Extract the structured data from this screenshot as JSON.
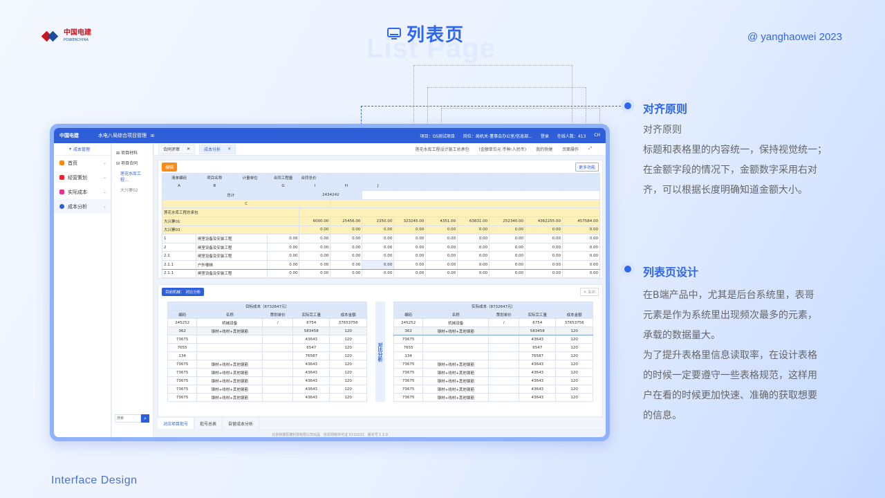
{
  "brand": {
    "name": "中国电建",
    "sub": "POWERCHINA"
  },
  "page": {
    "title": "列表页",
    "title_bg": "List Page",
    "author": "@ yanghaowei   2023",
    "footer": "Interface Design"
  },
  "colors": {
    "accent": "#2f66f0",
    "brand_red": "#c8161d",
    "warning": "#fa8c16"
  },
  "sections": [
    {
      "title": "对齐原则",
      "lines": [
        "对齐原则",
        "标题和表格里的内容统一，保持视觉统一；",
        "在金额字段的情况下，金额数字采用右对",
        "齐，可以根据长度明确知道金额大小。"
      ]
    },
    {
      "title": "列表页设计",
      "lines": [
        "在B端产品中，尤其是后台系统里，表哥",
        "元素是作为系统里出现频次最多的元素，",
        "承载的数据量大。",
        "为了提升表格里信息读取率，在设计表格",
        "的时候一定要遵守一些表格规范，这样用",
        "户在看的时候更加快速、准确的获取想要",
        "的信息。"
      ]
    }
  ],
  "app": {
    "brand": "中国电建",
    "brand_sub": "POWERCHINA",
    "name": "水电八局综合项目管理",
    "topbar": {
      "project": "项目：GS测试项目",
      "org": "岗位：局机关-董事会办公室/信息部...",
      "user": "登录",
      "online": "在线人数：413",
      "lang": "CH"
    },
    "side_header": "成本管理",
    "menu": [
      {
        "label": "首页",
        "icon": "home-icon",
        "color": "#fa8c16"
      },
      {
        "label": "经营策划",
        "icon": "plan-icon",
        "color": "#f5222d"
      },
      {
        "label": "实际成本",
        "icon": "cost-icon",
        "color": "#eb2f96"
      },
      {
        "label": "成本分析",
        "icon": "analysis-icon",
        "color": "#2f5fd8"
      }
    ],
    "tree": [
      "项目材料",
      "项目合同",
      "莲花水库工程...",
      "大兴寨02"
    ],
    "search_placeholder": "搜索",
    "tabs": [
      {
        "label": "合同评审"
      },
      {
        "label": "成本分析"
      }
    ],
    "tab_right": [
      "莲花水库工程设计施工总承包",
      "(金额单位元  币种:人民币)",
      "我的快捷",
      "页面操作"
    ],
    "btn_edit": "编辑",
    "btn_more": "更多功能",
    "main_header": [
      "清单编码",
      "项目名称",
      "计量单位",
      "合同工程量",
      "合同总价"
    ],
    "main_letters": [
      "A",
      "B",
      "",
      "G",
      "I",
      "H",
      "J"
    ],
    "total_label": "总计",
    "total_value": "2434242",
    "c_label": "C",
    "group_row": "莲花水库工程总承包",
    "rows": [
      {
        "code": "大兴寨01",
        "name": "",
        "vals": [
          "6000.00",
          "25456.00",
          "2350.00",
          "323245.00",
          "4351.00",
          "63831.00",
          "252340.00",
          "4362255.00",
          "457584.00"
        ],
        "style": "yel"
      },
      {
        "code": "大兴寨03",
        "name": "",
        "vals": [
          "0.00",
          "0.00",
          "0.00",
          "0.00",
          "0.00",
          "0.00",
          "0.00",
          "0.00",
          "0.00"
        ],
        "style": "yel"
      },
      {
        "code": "1",
        "name": "闸室设备及安装工程",
        "q": "0.00",
        "vals": [
          "0.00",
          "0.00",
          "0.00",
          "0.00",
          "0.00",
          "0.00",
          "0.00",
          "0.00",
          "0.00"
        ]
      },
      {
        "code": "2",
        "name": "闸室设备及安装工程",
        "q": "0.00",
        "vals": [
          "0.00",
          "0.00",
          "0.00",
          "0.00",
          "0.00",
          "0.00",
          "0.00",
          "0.00",
          "0.00"
        ]
      },
      {
        "code": "2.1",
        "name": "闸室设备及安装工程",
        "q": "0.00",
        "vals": [
          "0.00",
          "0.00",
          "0.00",
          "0.00",
          "0.00",
          "0.00",
          "0.00",
          "0.00",
          "0.00"
        ]
      },
      {
        "code": "2.1.1",
        "name": "户外楼梯",
        "q": "0.00",
        "vals": [
          "0.00",
          "0.00",
          "0.00",
          "0.00",
          "0.00",
          "0.00",
          "0.00",
          "0.00",
          "0.00"
        ],
        "style": "sel"
      },
      {
        "code": "2.1.1",
        "name": "闸室设备及安装工程",
        "q": "0.00",
        "vals": [
          "0.00",
          "0.00",
          "0.00",
          "0.00",
          "0.00",
          "0.00",
          "0.00",
          "0.00",
          "0.00"
        ]
      }
    ],
    "lower": {
      "selector": "目前机械：  对比分析",
      "close": "关闭",
      "left_title": "目标成本（8732647元）",
      "right_title": "实际成本（8732647元）",
      "cols": [
        "编码",
        "名称",
        "策划单价",
        "实际完工量",
        "成本金额"
      ],
      "mid": "对比分析",
      "rows": [
        [
          "245252",
          "机械设备",
          "/",
          "6754",
          "37653756"
        ],
        [
          "362",
          "钢材+线材+其他钢筋",
          "",
          "583458",
          "120"
        ],
        [
          "73675",
          "",
          "",
          "43643",
          "120"
        ],
        [
          "7655",
          "",
          "",
          "6547",
          "120"
        ],
        [
          "134",
          "",
          "",
          "76587",
          "120"
        ],
        [
          "73675",
          "钢材+线材+其他钢筋",
          "",
          "43643",
          "120"
        ],
        [
          "73675",
          "钢材+线材+其他钢筋",
          "",
          "43643",
          "120"
        ],
        [
          "73675",
          "钢材+线材+其他钢筋",
          "",
          "43643",
          "120"
        ],
        [
          "73675",
          "钢材+线材+其他钢筋",
          "",
          "43643",
          "120"
        ],
        [
          "73675",
          "钢材+线材+其他钢筋",
          "",
          "43643",
          "120"
        ]
      ]
    },
    "bottom_tabs": [
      "对应项目批号",
      "批号总表",
      "自营成本分析"
    ],
    "footer": [
      "北京特捷思捷科技有限公司出品",
      "信息网络许可证 0110231",
      "版本号 1.1.0"
    ]
  }
}
